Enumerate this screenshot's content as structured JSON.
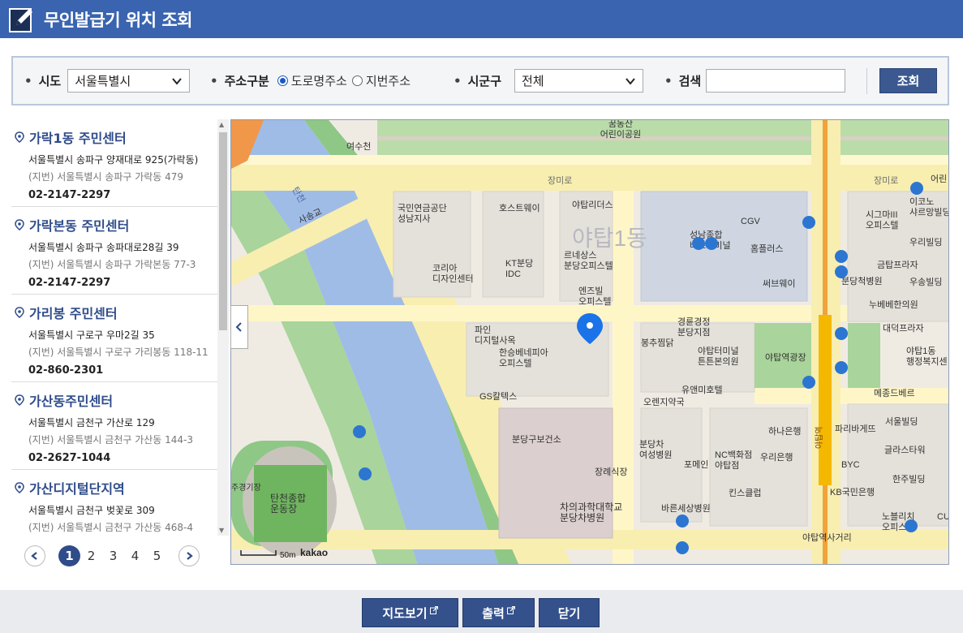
{
  "header": {
    "title": "무인발급기 위치 조회"
  },
  "search": {
    "sido_label": "시도",
    "sido_value": "서울특별시",
    "addr_type_label": "주소구분",
    "addr_options": [
      "도로명주소",
      "지번주소"
    ],
    "addr_selected": "도로명주소",
    "sigungu_label": "시군구",
    "sigungu_value": "전체",
    "keyword_label": "검색",
    "keyword_value": "",
    "search_button": "조회"
  },
  "results": [
    {
      "name": "가락1동 주민센터",
      "road": "서울특별시 송파구 양재대로 925(가락동)",
      "jibun": "(지번) 서울특별시 송파구 가락동 479",
      "tel": "02-2147-2297"
    },
    {
      "name": "가락본동 주민센터",
      "road": "서울특별시 송파구 송파대로28길 39",
      "jibun": "(지번) 서울특별시 송파구 가락본동 77-3",
      "tel": "02-2147-2297"
    },
    {
      "name": "가리봉 주민센터",
      "road": "서울특별시 구로구 우마2길 35",
      "jibun": "(지번) 서울특별시 구로구 가리봉동 118-11",
      "tel": "02-860-2301"
    },
    {
      "name": "가산동주민센터",
      "road": "서울특별시 금천구 가산로 129",
      "jibun": "(지번) 서울특별시 금천구 가산동 144-3",
      "tel": "02-2627-1044"
    },
    {
      "name": "가산디지털단지역",
      "road": "서울특별시 금천구 벚꽃로 309",
      "jibun": "(지번) 서울특별시 금천구 가산동 468-4",
      "tel": ""
    }
  ],
  "pagination": {
    "pages": [
      "1",
      "2",
      "3",
      "4",
      "5"
    ],
    "current": "1"
  },
  "map": {
    "labels": {
      "park_kids": "꿈동산\n어린이공원",
      "stream": "여수천",
      "tancheon": "탄천",
      "sasonggyo": "사송교",
      "jangmiro": "장미로",
      "jangmiro2": "장미로",
      "pension": "국민연금공단\n성남지사",
      "korea_design": "코리아\n디자인센터",
      "hostway": "호스트웨이",
      "kt": "KT분당\nIDC",
      "yatap_leaders": "야탑리더스",
      "renaissance": "르네상스\n분당오피스텔",
      "enzville": "엔즈빌\n오피스텔",
      "cgv": "CGV",
      "homeplus": "홈플러스",
      "terminal": "성남종합\n버스터미널",
      "subway": "써브웨이",
      "yatap1dong": "야탑1동",
      "pine": "파인\n디지털사옥",
      "hanseung": "한승베네피아\n오피스텔",
      "gs": "GS칼텍스",
      "bongchu": "봉추찜닭",
      "gyeongryun": "경륜경정\n분당지점",
      "terminal_clinic": "야탑터미널\n튼튼본의원",
      "yatap_square": "야탑역광장",
      "ewha": "유앤미호텔",
      "orange": "오렌지약국",
      "bundang_health": "분당구보건소",
      "jangrye": "장례식장",
      "cha": "차의과학대학교\n분당차병원",
      "cha_women": "분당차\n여성병원",
      "pomein": "포메인",
      "nc": "NC백화점\n야탑점",
      "kids_club": "킨스클럽",
      "hana": "하나은행",
      "woori": "우리은행",
      "bareun": "바른세상병원",
      "yatap_street": "야탑역사거리",
      "stadium": "탄천종합\n운동장",
      "stadium_side": "주경기장",
      "shigol": "시그마III\n오피스텔",
      "ikon": "이코노\n샤르망빌딩",
      "woori_bld": "우리빌딩",
      "geumtap": "금탑프라자",
      "usong": "우송빌딩",
      "bundang_jeong": "분당척병원",
      "nubel": "누베베한의원",
      "daewoo": "대덕프라자",
      "yatap1_admin": "야탑1동\n행정복지센",
      "menjo": "메종드베르",
      "paris": "파리바게뜨",
      "seoul_bld": "서울빌딩",
      "glass": "글라스타워",
      "byc": "BYC",
      "hanju": "한주빌딩",
      "kb": "KB국민은행",
      "noble": "노블리치\n오피스",
      "cu": "CU",
      "yatap_station": "야탑역",
      "kids": "어린",
      "scale": "50m",
      "brand": "kakao"
    }
  },
  "footer": {
    "map_view": "지도보기",
    "print": "출력",
    "close": "닫기"
  },
  "colors": {
    "header_bg": "#3a64b0",
    "accent_dark": "#34518c",
    "link": "#2f4c8a",
    "marker": "#1a73e8"
  }
}
